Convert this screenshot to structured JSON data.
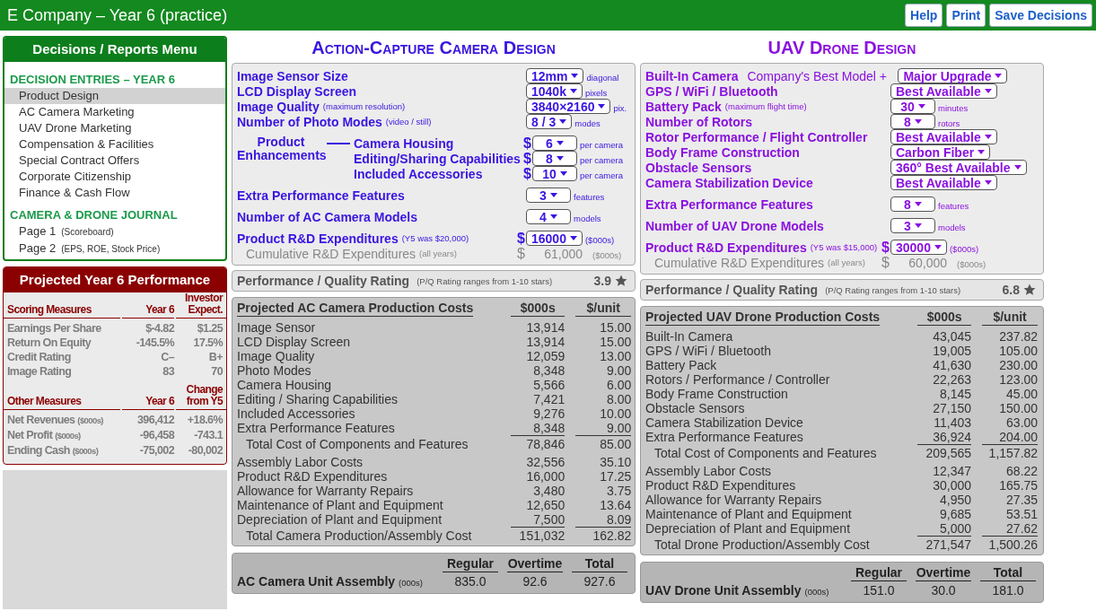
{
  "header": {
    "title": "E Company – Year 6 (practice)",
    "buttons": [
      "Help",
      "Print",
      "Save Decisions"
    ]
  },
  "menu": {
    "title": "Decisions / Reports Menu",
    "sections": [
      {
        "heading": "DECISION ENTRIES – YEAR 6",
        "items": [
          {
            "label": "Product Design",
            "selected": true
          },
          {
            "label": "AC Camera Marketing",
            "selected": false
          },
          {
            "label": "UAV Drone Marketing",
            "selected": false
          },
          {
            "label": "Compensation & Facilities",
            "selected": false
          },
          {
            "label": "Special Contract Offers",
            "selected": false
          },
          {
            "label": "Corporate Citizenship",
            "selected": false
          },
          {
            "label": "Finance & Cash Flow",
            "selected": false
          }
        ]
      },
      {
        "heading": "CAMERA & DRONE JOURNAL",
        "items": [
          {
            "label": "Page 1",
            "note": "(Scoreboard)",
            "selected": false
          },
          {
            "label": "Page 2",
            "note": "(EPS, ROE, Stock Price)",
            "selected": false
          }
        ]
      }
    ]
  },
  "performance": {
    "title": "Projected Year 6 Performance",
    "groups": [
      {
        "columns": [
          "Scoring Measures",
          "Year 6",
          "Investor Expect."
        ],
        "rows": [
          {
            "label": "Earnings Per Share",
            "values": [
              "$-4.82",
              "$1.25"
            ]
          },
          {
            "label": "Return On Equity",
            "values": [
              "-145.5%",
              "17.5%"
            ]
          },
          {
            "label": "Credit Rating",
            "values": [
              "C–",
              "B+"
            ]
          },
          {
            "label": "Image Rating",
            "values": [
              "83",
              "70"
            ]
          }
        ]
      },
      {
        "columns": [
          "Other Measures",
          "Year 6",
          "Change from Y5"
        ],
        "rows": [
          {
            "label": "Net Revenues",
            "note": "($000s)",
            "values": [
              "396,412",
              "+18.6%"
            ]
          },
          {
            "label": "Net Profit",
            "note": "($000s)",
            "values": [
              "-96,458",
              "-743.1"
            ]
          },
          {
            "label": "Ending Cash",
            "note": "($000s)",
            "values": [
              "-75,002",
              "-80,002"
            ]
          }
        ]
      }
    ]
  },
  "designs": [
    {
      "title": "Action-Capture Camera Design",
      "sections": [
        [
          {
            "kind": "select",
            "label": "Image Sensor Size",
            "value": "12mm",
            "unit": "diagonal"
          },
          {
            "kind": "select",
            "label": "LCD Display Screen",
            "value": "1040k",
            "unit": "pixels"
          },
          {
            "kind": "select",
            "label": "Image Quality",
            "note": "(maximum resolution)",
            "value": "3840×2160",
            "unit": "pix."
          },
          {
            "kind": "select",
            "label": "Number of Photo Modes",
            "note": "(video / still)",
            "value": "8 / 3",
            "unit": "modes"
          }
        ],
        [
          {
            "kind": "group",
            "label": "Product Enhancements",
            "items": [
              {
                "label": "Camera Housing",
                "currency": "$",
                "value": "6",
                "unit": "per camera"
              },
              {
                "label": "Editing/Sharing Capabilities",
                "currency": "$",
                "value": "8",
                "unit": "per camera"
              },
              {
                "label": "Included Accessories",
                "currency": "$",
                "value": "10",
                "unit": "per camera"
              }
            ]
          }
        ],
        [
          {
            "kind": "select",
            "label": "Extra Performance Features",
            "value": "3",
            "unit": "features"
          }
        ],
        [
          {
            "kind": "select",
            "label": "Number of AC Camera Models",
            "value": "4",
            "unit": "models"
          }
        ],
        [
          {
            "kind": "select",
            "label": "Product R&D Expenditures",
            "note": "(Y5 was $20,000)",
            "currency": "$",
            "value": "16000",
            "unit": "($000s)"
          },
          {
            "kind": "readout",
            "label": "Cumulative R&D Expenditures",
            "note": "(all years)",
            "currency": "$",
            "value": "61,000",
            "unit": "($000s)"
          }
        ]
      ],
      "rating": {
        "label": "Performance / Quality Rating",
        "note": "(P/Q Rating ranges from 1-10 stars)",
        "value": "3.9"
      },
      "costs": {
        "title": "Projected AC Camera Production Costs",
        "columns": [
          "$000s",
          "$/unit"
        ],
        "sections": [
          {
            "rows": [
              {
                "label": "Image Sensor",
                "values": [
                  "13,914",
                  "15.00"
                ]
              },
              {
                "label": "LCD Display Screen",
                "values": [
                  "13,914",
                  "15.00"
                ]
              },
              {
                "label": "Image Quality",
                "values": [
                  "12,059",
                  "13.00"
                ]
              },
              {
                "label": "Photo Modes",
                "values": [
                  "8,348",
                  "9.00"
                ]
              },
              {
                "label": "Camera Housing",
                "values": [
                  "5,566",
                  "6.00"
                ]
              },
              {
                "label": "Editing / Sharing Capabilities",
                "values": [
                  "7,421",
                  "8.00"
                ]
              },
              {
                "label": "Included Accessories",
                "values": [
                  "9,276",
                  "10.00"
                ]
              },
              {
                "label": "Extra Performance Features",
                "values": [
                  "8,348",
                  "9.00"
                ]
              }
            ],
            "total": {
              "label": "Total Cost of Components and Features",
              "values": [
                "78,846",
                "85.00"
              ]
            }
          },
          {
            "rows": [
              {
                "label": "Assembly Labor Costs",
                "values": [
                  "32,556",
                  "35.10"
                ]
              },
              {
                "label": "Product R&D Expenditures",
                "values": [
                  "16,000",
                  "17.25"
                ]
              },
              {
                "label": "Allowance for Warranty Repairs",
                "values": [
                  "3,480",
                  "3.75"
                ]
              },
              {
                "label": "Maintenance of Plant and Equipment",
                "values": [
                  "12,650",
                  "13.64"
                ]
              },
              {
                "label": "Depreciation of Plant and Equipment",
                "values": [
                  "7,500",
                  "8.09"
                ]
              }
            ],
            "total": {
              "label": "Total Camera Production/Assembly Cost",
              "values": [
                "151,032",
                "162.82"
              ]
            }
          }
        ]
      },
      "assembly": {
        "label": "AC Camera Unit Assembly",
        "note": "(000s)",
        "columns": [
          "Regular",
          "Overtime",
          "Total"
        ],
        "values": [
          "835.0",
          "92.6",
          "927.6"
        ]
      }
    },
    {
      "title": "UAV Drone Design",
      "sections": [
        [
          {
            "kind": "select",
            "label": "Built-In Camera",
            "prefix": "Company's Best Model +",
            "value": "Major Upgrade"
          },
          {
            "kind": "select",
            "label": "GPS / WiFi / Bluetooth",
            "value": "Best Available"
          },
          {
            "kind": "select",
            "label": "Battery Pack",
            "note": "(maximum flight time)",
            "value": "30",
            "unit": "minutes"
          },
          {
            "kind": "select",
            "label": "Number of Rotors",
            "value": "8",
            "unit": "rotors"
          },
          {
            "kind": "select",
            "label": "Rotor Performance / Flight Controller",
            "value": "Best Available"
          },
          {
            "kind": "select",
            "label": "Body Frame Construction",
            "value": "Carbon Fiber"
          },
          {
            "kind": "select",
            "label": "Obstacle Sensors",
            "value": "360° Best Available"
          },
          {
            "kind": "select",
            "label": "Camera Stabilization Device",
            "value": "Best Available"
          }
        ],
        [
          {
            "kind": "select",
            "label": "Extra Performance Features",
            "value": "8",
            "unit": "features"
          }
        ],
        [
          {
            "kind": "select",
            "label": "Number of UAV Drone Models",
            "value": "3",
            "unit": "models"
          }
        ],
        [
          {
            "kind": "select",
            "label": "Product R&D Expenditures",
            "note": "(Y5 was $15,000)",
            "currency": "$",
            "value": "30000",
            "unit": "($000s)"
          },
          {
            "kind": "readout",
            "label": "Cumulative R&D Expenditures",
            "note": "(all years)",
            "currency": "$",
            "value": "60,000",
            "unit": "($000s)"
          }
        ]
      ],
      "rating": {
        "label": "Performance / Quality Rating",
        "note": "(P/Q Rating ranges from 1-10 stars)",
        "value": "6.8"
      },
      "costs": {
        "title": "Projected UAV Drone Production Costs",
        "columns": [
          "$000s",
          "$/unit"
        ],
        "sections": [
          {
            "rows": [
              {
                "label": "Built-In Camera",
                "values": [
                  "43,045",
                  "237.82"
                ]
              },
              {
                "label": "GPS / WiFi / Bluetooth",
                "values": [
                  "19,005",
                  "105.00"
                ]
              },
              {
                "label": "Battery Pack",
                "values": [
                  "41,630",
                  "230.00"
                ]
              },
              {
                "label": "Rotors / Performance / Controller",
                "values": [
                  "22,263",
                  "123.00"
                ]
              },
              {
                "label": "Body Frame Construction",
                "values": [
                  "8,145",
                  "45.00"
                ]
              },
              {
                "label": "Obstacle Sensors",
                "values": [
                  "27,150",
                  "150.00"
                ]
              },
              {
                "label": "Camera Stabilization Device",
                "values": [
                  "11,403",
                  "63.00"
                ]
              },
              {
                "label": "Extra Performance Features",
                "values": [
                  "36,924",
                  "204.00"
                ]
              }
            ],
            "total": {
              "label": "Total Cost of Components and Features",
              "values": [
                "209,565",
                "1,157.82"
              ]
            }
          },
          {
            "rows": [
              {
                "label": "Assembly Labor Costs",
                "values": [
                  "12,347",
                  "68.22"
                ]
              },
              {
                "label": "Product R&D Expenditures",
                "values": [
                  "30,000",
                  "165.75"
                ]
              },
              {
                "label": "Allowance for Warranty Repairs",
                "values": [
                  "4,950",
                  "27.35"
                ]
              },
              {
                "label": "Maintenance of Plant and Equipment",
                "values": [
                  "9,685",
                  "53.51"
                ]
              },
              {
                "label": "Depreciation of Plant and Equipment",
                "values": [
                  "5,000",
                  "27.62"
                ]
              }
            ],
            "total": {
              "label": "Total Drone Production/Assembly Cost",
              "values": [
                "271,547",
                "1,500.26"
              ]
            }
          }
        ]
      },
      "assembly": {
        "label": "UAV Drone Unit Assembly",
        "note": "(000s)",
        "columns": [
          "Regular",
          "Overtime",
          "Total"
        ],
        "values": [
          "151.0",
          "30.0",
          "181.0"
        ]
      }
    }
  ]
}
